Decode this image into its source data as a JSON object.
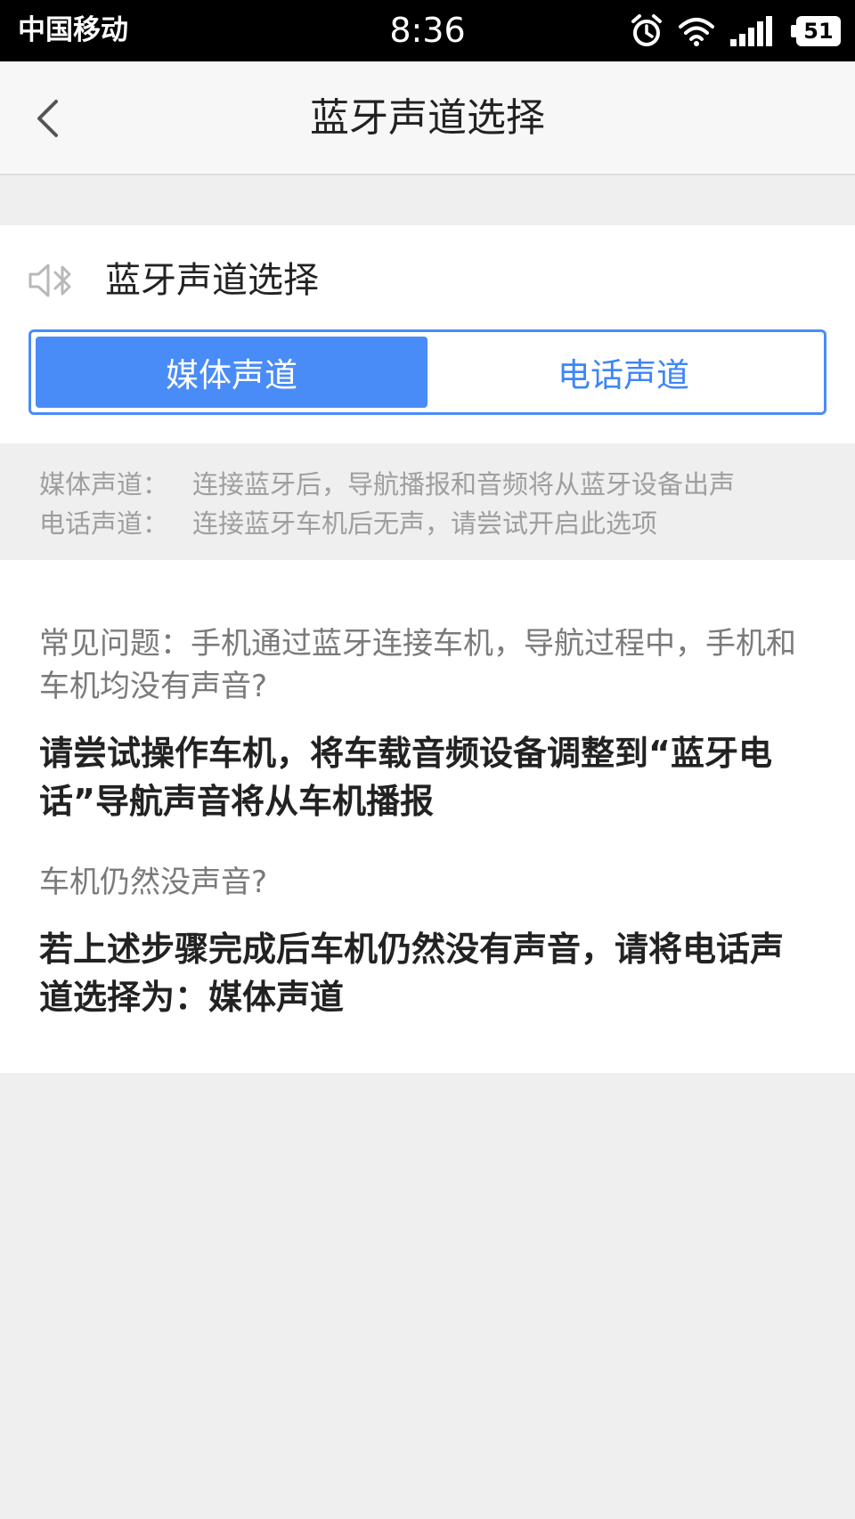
{
  "status_bar": {
    "carrier": "中国移动",
    "time": "8:36",
    "battery": "51",
    "icons": [
      "alarm-icon",
      "wifi-icon",
      "signal-icon",
      "battery-icon"
    ]
  },
  "nav": {
    "title": "蓝牙声道选择",
    "back_icon": "chevron-left-icon"
  },
  "channel": {
    "header_icon": "speaker-bluetooth-icon",
    "title": "蓝牙声道选择",
    "options": [
      {
        "label": "媒体声道",
        "selected": true
      },
      {
        "label": "电话声道",
        "selected": false
      }
    ],
    "accent_color": "#4a8cf7"
  },
  "info": [
    {
      "label": "媒体声道：",
      "text": "连接蓝牙后，导航播报和音频将从蓝牙设备出声"
    },
    {
      "label": "电话声道：",
      "text": "连接蓝牙车机后无声，请尝试开启此选项"
    }
  ],
  "faq": [
    {
      "question": "常见问题：手机通过蓝牙连接车机，导航过程中，手机和车机均没有声音?",
      "answer": "请尝试操作车机，将车载音频设备调整到“蓝牙电话”导航声音将从车机播报"
    },
    {
      "question": "车机仍然没声音?",
      "answer": "若上述步骤完成后车机仍然没有声音，请将电话声道选择为：媒体声道"
    }
  ]
}
